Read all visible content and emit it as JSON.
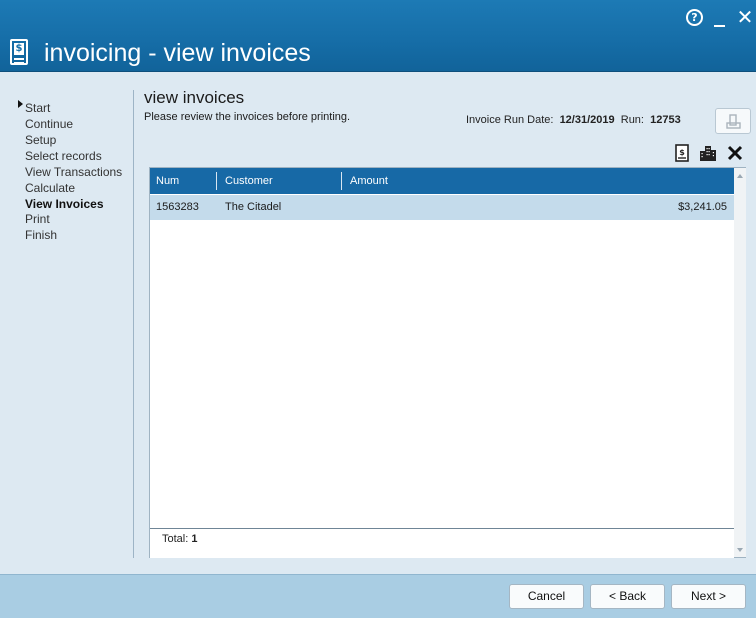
{
  "window": {
    "title": "invoicing - view invoices",
    "help_glyph": "?",
    "close_glyph": "✕"
  },
  "steps": [
    {
      "label": "Start"
    },
    {
      "label": "Continue"
    },
    {
      "label": "Setup"
    },
    {
      "label": "Select records"
    },
    {
      "label": "View Transactions"
    },
    {
      "label": "Calculate"
    },
    {
      "label": "View Invoices",
      "active": true
    },
    {
      "label": "Print"
    },
    {
      "label": "Finish"
    }
  ],
  "page": {
    "title": "view invoices",
    "subtitle": "Please review the invoices before printing.",
    "run_date_label": "Invoice Run Date:",
    "run_date_value": "12/31/2019",
    "run_label": "Run:",
    "run_value": "12753"
  },
  "toolbar": {
    "icons": [
      "invoice-icon",
      "buildings-icon",
      "delete-icon"
    ]
  },
  "grid": {
    "columns": [
      "Num",
      "Customer",
      "Amount"
    ],
    "rows": [
      {
        "num": "1563283",
        "customer": "The Citadel",
        "amount": "$3,241.05"
      }
    ],
    "total_label": "Total:",
    "total_value": "1"
  },
  "buttons": {
    "cancel": "Cancel",
    "back": "< Back",
    "next": "Next >"
  },
  "colors": {
    "title_bar": "#166ea8",
    "grid_header": "#1769a6",
    "selected_row": "#c4dbeb",
    "footer_bar": "#a9cde3"
  }
}
